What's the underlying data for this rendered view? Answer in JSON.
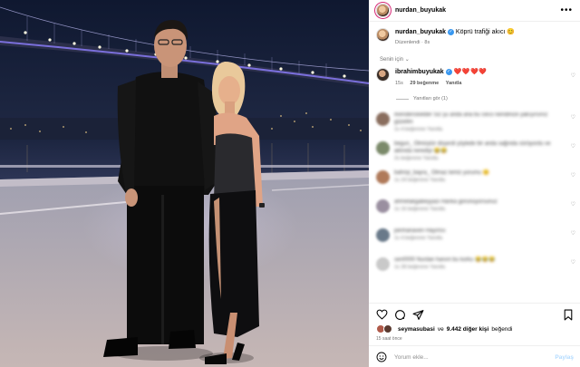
{
  "post": {
    "username": "nurdan_buyukak",
    "caption_text": "Köprü trafiği akıcı 😊",
    "edited_label": "Düzenlendi",
    "caption_age": "8s",
    "for_you_label": "Senin için",
    "more_icon": "more-horizontal-icon"
  },
  "featured_reply": {
    "username": "ibrahimbuyukak",
    "text": "❤️❤️❤️❤️",
    "age": "15s",
    "likes": "29 beğenme",
    "reply_label": "Yanıtla",
    "see_replies": "Yanıtları gör (1)"
  },
  "comments": [
    {
      "text": "ilvenderiskelder Siz şu anda ana bu sıkıcı kendinize yakışırsınız güzelim",
      "meta": "1s  4 beğenme  Yanıtla",
      "avatar_color": "#8a6e5e"
    },
    {
      "text": "begun_ Ölmüştür düşerdi şöylede bir anda sağında sürüyordu ve aklında nerediyi 😂😂",
      "meta": "2s beğenme  Yanıtla",
      "avatar_color": "#7b8a6a"
    },
    {
      "text": "bahriyi_bayra_ Olmaz temiz yorumu 😊",
      "meta": "1s  24 beğenme  Yanıtla",
      "avatar_color": "#b07a5a"
    },
    {
      "text": "ahmetakgabeyyazi Harika görünüyorsunuz",
      "meta": "1s  16 beğenme  Yanıtla",
      "avatar_color": "#9a8fa0"
    },
    {
      "text": "perihanaven Hayırlısı",
      "meta": "1s  4 beğenme  Yanıtla",
      "avatar_color": "#6a7a8a"
    },
    {
      "text": "sen0000 Nurdan hanım bu korku 😂😂😂",
      "meta": "1s  28 beğenme  Yanıtla",
      "avatar_color": "#c9c9c9"
    }
  ],
  "actions": {
    "like_icon": "heart-icon",
    "comment_icon": "comment-icon",
    "share_icon": "send-icon",
    "save_icon": "bookmark-icon"
  },
  "likes_line": {
    "first_liker": "seymasubasi",
    "connector": "ve",
    "others": "9.442 diğer kişi",
    "suffix": "beğendi"
  },
  "time_ago": "15 saat önce",
  "comment_box": {
    "placeholder": "Yorum ekle...",
    "post_label": "Paylaş"
  }
}
